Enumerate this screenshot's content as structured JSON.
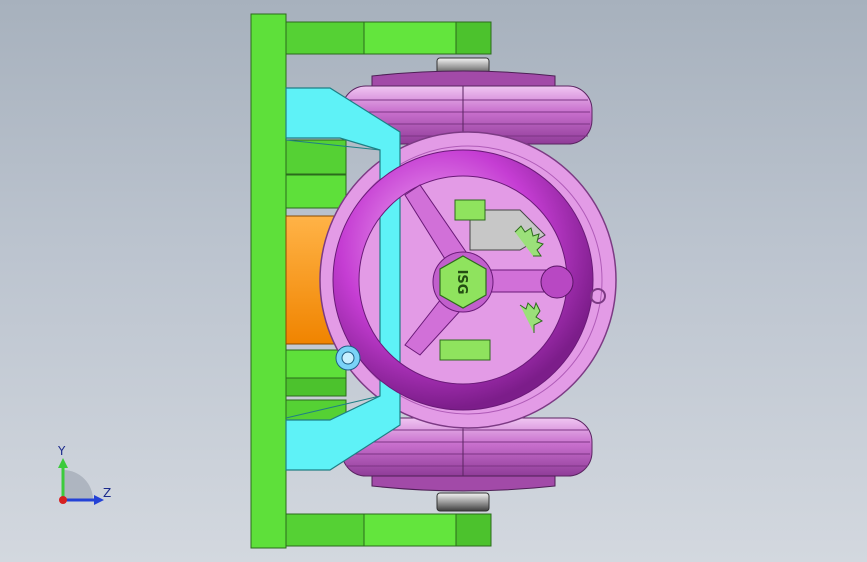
{
  "viewport": {
    "name": "cad-3d-viewport",
    "background_top": "#a7b1bd",
    "background_bottom": "#d3d8df"
  },
  "model": {
    "hub_label": "ISG",
    "colors": {
      "frame_green": "#5ee03a",
      "frame_green_dark": "#2f8f1e",
      "bracket_cyan": "#5ef2f7",
      "block_orange": "#ff9a12",
      "wheel_pink": "#d67ad9",
      "handwheel_magenta": "#c23fd0",
      "handwheel_light": "#e39be6",
      "hub_green": "#8fe35e",
      "gear_gray": "#c7c7c7"
    }
  },
  "triad": {
    "y_label": "Y",
    "z_label": "Z",
    "y_color": "#3ccb3c",
    "z_color": "#2442d6",
    "x_color": "#d62020"
  }
}
